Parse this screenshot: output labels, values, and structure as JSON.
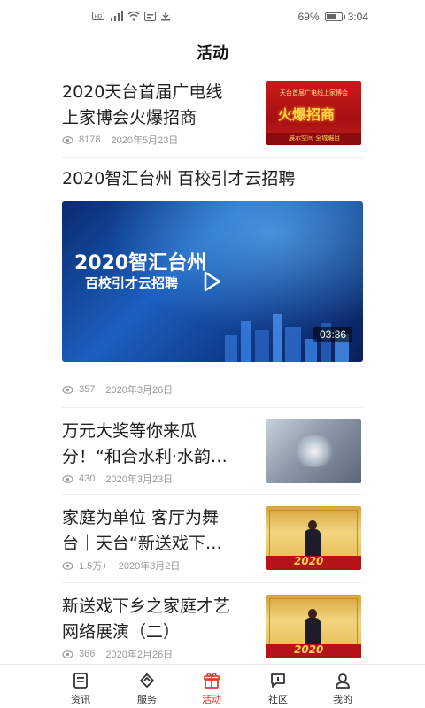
{
  "status_bar": {
    "left_icons": [
      "hd-icon",
      "signal-4g-icon",
      "wifi-icon",
      "notification-icon",
      "download-icon"
    ],
    "battery": "69%",
    "battery_level": 0.69,
    "time": "3:04"
  },
  "header": {
    "title": "活动"
  },
  "feed": {
    "items": [
      {
        "title_lines": [
          "2020天台首届广电线",
          "上家博会火爆招商"
        ],
        "views": "8178",
        "date": "2020年5月23日",
        "thumb": {
          "tag": "天台首届广电线上家博会",
          "headline": "火爆招商",
          "sub": "展示空间 全城瞩目"
        }
      },
      {
        "title": "2020智汇台州 百校引才云招聘",
        "views": "357",
        "date": "2020年3月26日",
        "video": {
          "title": "2020智汇台州",
          "subtitle": "百校引才云招聘",
          "duration": "03:36"
        }
      },
      {
        "title_lines": [
          "万元大奖等你来瓜",
          "分！“和合水利·水韵…"
        ],
        "views": "430",
        "date": "2020年3月23日"
      },
      {
        "title_lines": [
          "家庭为单位 客厅为舞",
          "台｜天台“新送戏下…"
        ],
        "views": "1.5万+",
        "date": "2020年3月2日",
        "thumb": {
          "year": "2020"
        }
      },
      {
        "title_lines": [
          "新送戏下乡之家庭才艺",
          "网络展演（二）"
        ],
        "views": "366",
        "date": "2020年2月26日",
        "thumb": {
          "year": "2020"
        }
      }
    ]
  },
  "tabbar": {
    "active": "活动",
    "active_color": "#e53935",
    "tabs": [
      {
        "label": "资讯",
        "icon": "news-icon"
      },
      {
        "label": "服务",
        "icon": "service-icon"
      },
      {
        "label": "活动",
        "icon": "gift-icon"
      },
      {
        "label": "社区",
        "icon": "community-icon"
      },
      {
        "label": "我的",
        "icon": "profile-icon"
      }
    ]
  }
}
